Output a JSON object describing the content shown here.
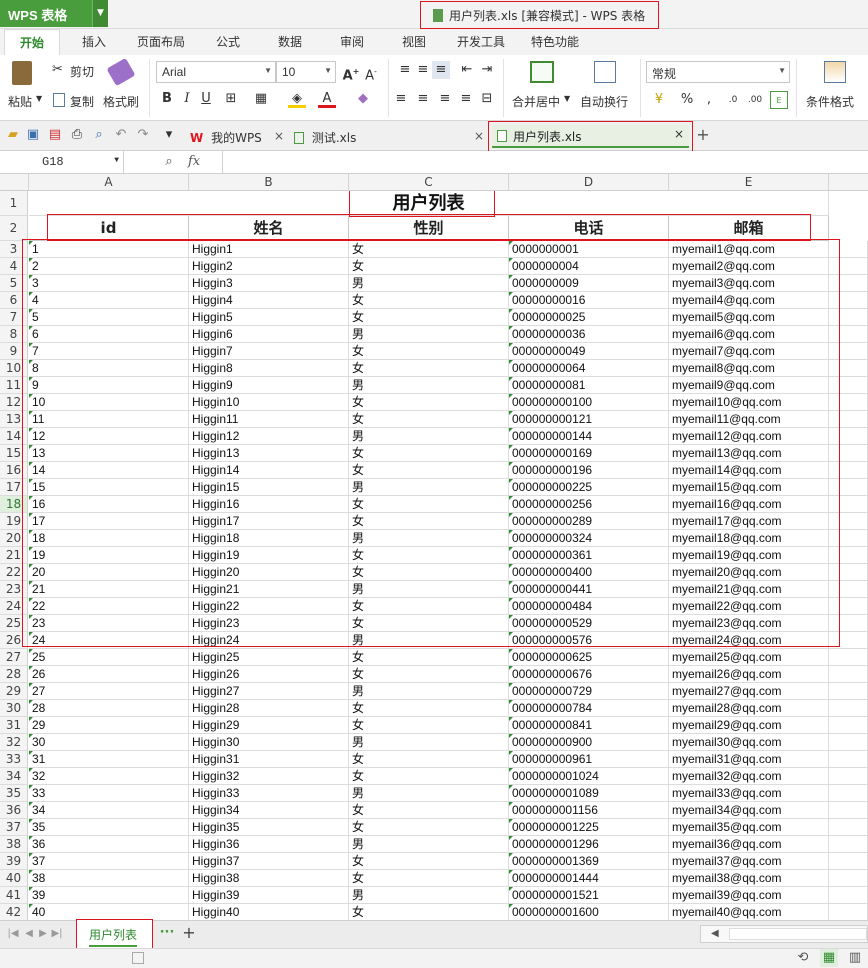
{
  "app": {
    "name": "WPS 表格",
    "window_title": "用户列表.xls [兼容模式] - WPS 表格"
  },
  "ribbon_tabs": [
    "开始",
    "插入",
    "页面布局",
    "公式",
    "数据",
    "审阅",
    "视图",
    "开发工具",
    "特色功能"
  ],
  "ribbon": {
    "paste": "粘贴",
    "cut": "剪切",
    "copy": "复制",
    "format_painter": "格式刷",
    "font_name": "Arial",
    "font_size": "10",
    "merge_center": "合并居中",
    "wrap_text": "自动换行",
    "number_format": "常规",
    "conditional_format": "条件格式"
  },
  "doc_tabs": [
    {
      "label": "我的WPS"
    },
    {
      "label": "测试.xls"
    },
    {
      "label": "用户列表.xls",
      "active": true
    }
  ],
  "formula_bar": {
    "name_box": "G18",
    "fx": "fx",
    "formula": ""
  },
  "columns": [
    "A",
    "B",
    "C",
    "D",
    "E"
  ],
  "sheet": {
    "title": "用户列表",
    "headers": [
      "id",
      "姓名",
      "性别",
      "电话",
      "邮箱"
    ],
    "rows": [
      [
        "1",
        "Higgin1",
        "女",
        "0000000001",
        "myemail1@qq.com"
      ],
      [
        "2",
        "Higgin2",
        "女",
        "0000000004",
        "myemail2@qq.com"
      ],
      [
        "3",
        "Higgin3",
        "男",
        "0000000009",
        "myemail3@qq.com"
      ],
      [
        "4",
        "Higgin4",
        "女",
        "00000000016",
        "myemail4@qq.com"
      ],
      [
        "5",
        "Higgin5",
        "女",
        "00000000025",
        "myemail5@qq.com"
      ],
      [
        "6",
        "Higgin6",
        "男",
        "00000000036",
        "myemail6@qq.com"
      ],
      [
        "7",
        "Higgin7",
        "女",
        "00000000049",
        "myemail7@qq.com"
      ],
      [
        "8",
        "Higgin8",
        "女",
        "00000000064",
        "myemail8@qq.com"
      ],
      [
        "9",
        "Higgin9",
        "男",
        "00000000081",
        "myemail9@qq.com"
      ],
      [
        "10",
        "Higgin10",
        "女",
        "000000000100",
        "myemail10@qq.com"
      ],
      [
        "11",
        "Higgin11",
        "女",
        "000000000121",
        "myemail11@qq.com"
      ],
      [
        "12",
        "Higgin12",
        "男",
        "000000000144",
        "myemail12@qq.com"
      ],
      [
        "13",
        "Higgin13",
        "女",
        "000000000169",
        "myemail13@qq.com"
      ],
      [
        "14",
        "Higgin14",
        "女",
        "000000000196",
        "myemail14@qq.com"
      ],
      [
        "15",
        "Higgin15",
        "男",
        "000000000225",
        "myemail15@qq.com"
      ],
      [
        "16",
        "Higgin16",
        "女",
        "000000000256",
        "myemail16@qq.com"
      ],
      [
        "17",
        "Higgin17",
        "女",
        "000000000289",
        "myemail17@qq.com"
      ],
      [
        "18",
        "Higgin18",
        "男",
        "000000000324",
        "myemail18@qq.com"
      ],
      [
        "19",
        "Higgin19",
        "女",
        "000000000361",
        "myemail19@qq.com"
      ],
      [
        "20",
        "Higgin20",
        "女",
        "000000000400",
        "myemail20@qq.com"
      ],
      [
        "21",
        "Higgin21",
        "男",
        "000000000441",
        "myemail21@qq.com"
      ],
      [
        "22",
        "Higgin22",
        "女",
        "000000000484",
        "myemail22@qq.com"
      ],
      [
        "23",
        "Higgin23",
        "女",
        "000000000529",
        "myemail23@qq.com"
      ],
      [
        "24",
        "Higgin24",
        "男",
        "000000000576",
        "myemail24@qq.com"
      ],
      [
        "25",
        "Higgin25",
        "女",
        "000000000625",
        "myemail25@qq.com"
      ],
      [
        "26",
        "Higgin26",
        "女",
        "000000000676",
        "myemail26@qq.com"
      ],
      [
        "27",
        "Higgin27",
        "男",
        "000000000729",
        "myemail27@qq.com"
      ],
      [
        "28",
        "Higgin28",
        "女",
        "000000000784",
        "myemail28@qq.com"
      ],
      [
        "29",
        "Higgin29",
        "女",
        "000000000841",
        "myemail29@qq.com"
      ],
      [
        "30",
        "Higgin30",
        "男",
        "000000000900",
        "myemail30@qq.com"
      ],
      [
        "31",
        "Higgin31",
        "女",
        "000000000961",
        "myemail31@qq.com"
      ],
      [
        "32",
        "Higgin32",
        "女",
        "0000000001024",
        "myemail32@qq.com"
      ],
      [
        "33",
        "Higgin33",
        "男",
        "0000000001089",
        "myemail33@qq.com"
      ],
      [
        "34",
        "Higgin34",
        "女",
        "0000000001156",
        "myemail34@qq.com"
      ],
      [
        "35",
        "Higgin35",
        "女",
        "0000000001225",
        "myemail35@qq.com"
      ],
      [
        "36",
        "Higgin36",
        "男",
        "0000000001296",
        "myemail36@qq.com"
      ],
      [
        "37",
        "Higgin37",
        "女",
        "0000000001369",
        "myemail37@qq.com"
      ],
      [
        "38",
        "Higgin38",
        "女",
        "0000000001444",
        "myemail38@qq.com"
      ],
      [
        "39",
        "Higgin39",
        "男",
        "0000000001521",
        "myemail39@qq.com"
      ],
      [
        "40",
        "Higgin40",
        "女",
        "0000000001600",
        "myemail40@qq.com"
      ]
    ]
  },
  "sheet_tabs": [
    "用户列表"
  ],
  "selected_row": 18,
  "colors": {
    "brand": "#4a9d3c",
    "highlight": "#e0141e",
    "active_tab": "#2d8a2d"
  }
}
